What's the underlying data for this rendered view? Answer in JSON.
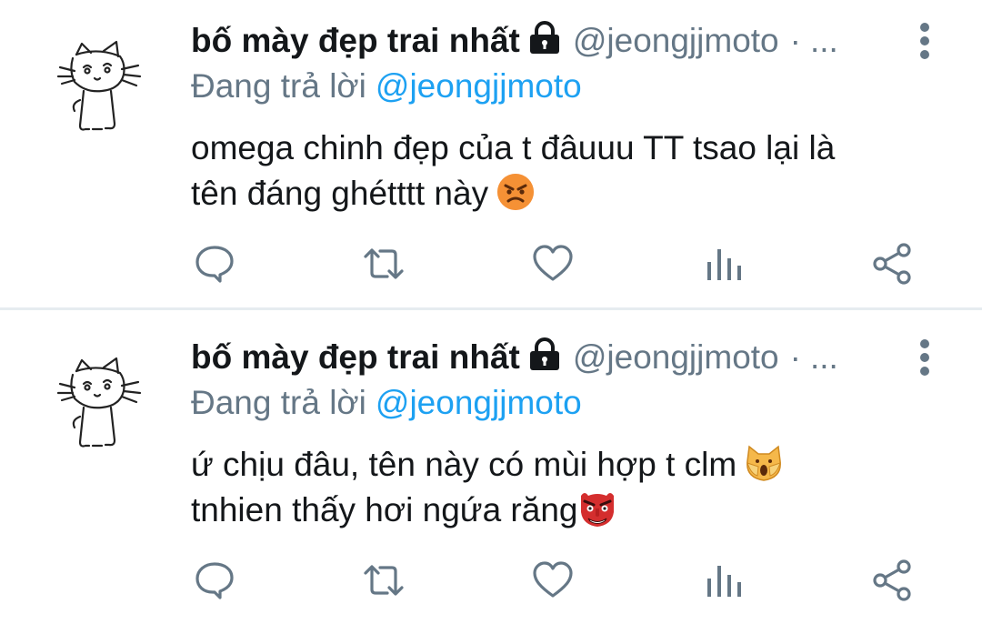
{
  "colors": {
    "text": "#14171a",
    "muted": "#657786",
    "accent": "#1da1f2",
    "divider": "#e6ecf0",
    "icon": "#657786"
  },
  "tweets": [
    {
      "display_name": "bố mày đẹp trai nhất",
      "handle": "@jeongjjmoto",
      "separator": "·",
      "overflow": "...",
      "reply_label": "Đang trả lời",
      "reply_to": "@jeongjjmoto",
      "body_lines": [
        "omega chinh đẹp của t đâuuu TT tsao lại là",
        "tên đáng ghétttt này"
      ],
      "emojis": [
        "angry-face-emoji"
      ],
      "icons": [
        "avatar-cat",
        "lock-icon",
        "more-vertical-icon",
        "reply-icon",
        "retweet-icon",
        "like-icon",
        "stats-icon",
        "share-icon"
      ]
    },
    {
      "display_name": "bố mày đẹp trai nhất",
      "handle": "@jeongjjmoto",
      "separator": "·",
      "overflow": "...",
      "reply_label": "Đang trả lời",
      "reply_to": "@jeongjjmoto",
      "body_lines": [
        "ứ chịu đâu, tên này có mùi hợp t clm",
        "tnhien thấy hơi ngứa răng"
      ],
      "emojis": [
        "weary-cat-emoji",
        "goblin-mask-emoji"
      ],
      "icons": [
        "avatar-cat",
        "lock-icon",
        "more-vertical-icon",
        "reply-icon",
        "retweet-icon",
        "like-icon",
        "stats-icon",
        "share-icon"
      ]
    }
  ]
}
